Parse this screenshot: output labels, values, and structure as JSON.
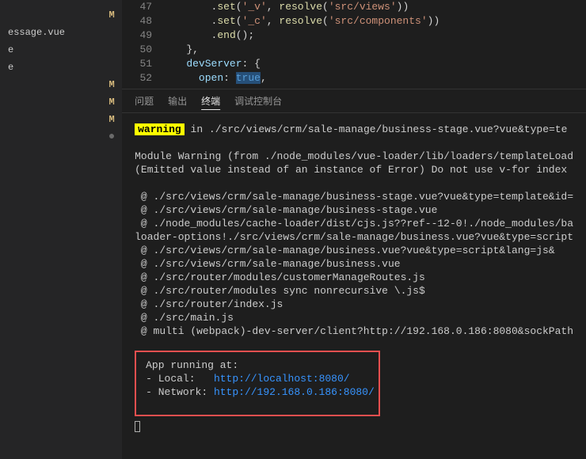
{
  "sidebar": {
    "items": [
      {
        "name": "",
        "status": "M"
      },
      {
        "name": "essage.vue",
        "status": ""
      },
      {
        "name": "e",
        "status": ""
      },
      {
        "name": "e",
        "status": ""
      },
      {
        "name": "",
        "status": "M"
      },
      {
        "name": "",
        "status": "M"
      },
      {
        "name": "",
        "status": "M"
      },
      {
        "name": "",
        "status": "●"
      }
    ]
  },
  "editor": {
    "lines": [
      {
        "num": "47",
        "indent": "        ",
        "tokens": [
          ".",
          "set",
          "(",
          "'_v'",
          ", ",
          "resolve",
          "(",
          "'src/views'",
          "))"
        ]
      },
      {
        "num": "48",
        "indent": "        ",
        "tokens": [
          ".",
          "set",
          "(",
          "'_c'",
          ", ",
          "resolve",
          "(",
          "'src/components'",
          "))"
        ]
      },
      {
        "num": "49",
        "indent": "        ",
        "tokens": [
          ".",
          "end",
          "();"
        ]
      },
      {
        "num": "50",
        "indent": "    ",
        "tokens": [
          "},"
        ]
      },
      {
        "num": "51",
        "indent": "    ",
        "prop": "devServer",
        "tokens": [
          ": {"
        ]
      },
      {
        "num": "52",
        "indent": "      ",
        "prop": "open",
        "tokens": [
          ": "
        ],
        "kwval": "true",
        "after": ","
      }
    ]
  },
  "panel": {
    "tabs": {
      "problems": "问题",
      "output": "输出",
      "terminal": "终端",
      "debug": "调试控制台"
    }
  },
  "terminal": {
    "warning_label": "warning",
    "warning_text": " in ./src/views/crm/sale-manage/business-stage.vue?vue&type=te",
    "module_line1": "Module Warning (from ./node_modules/vue-loader/lib/loaders/templateLoad",
    "module_line2": "(Emitted value instead of an instance of Error) Do not use v-for index ",
    "at": [
      " @ ./src/views/crm/sale-manage/business-stage.vue?vue&type=template&id=",
      " @ ./src/views/crm/sale-manage/business-stage.vue",
      " @ ./node_modules/cache-loader/dist/cjs.js??ref--12-0!./node_modules/ba",
      "loader-options!./src/views/crm/sale-manage/business.vue?vue&type=script",
      " @ ./src/views/crm/sale-manage/business.vue?vue&type=script&lang=js&",
      " @ ./src/views/crm/sale-manage/business.vue",
      " @ ./src/router/modules/customerManageRoutes.js",
      " @ ./src/router/modules sync nonrecursive \\.js$",
      " @ ./src/router/index.js",
      " @ ./src/main.js",
      " @ multi (webpack)-dev-server/client?http://192.168.0.186:8080&sockPath"
    ],
    "running": {
      "title": "App running at:",
      "local_label": "- Local:   ",
      "local_url_prefix": "http://localhost:",
      "local_port": "8080",
      "local_suffix": "/",
      "network_label": "- Network: ",
      "network_url_prefix": "http://192.168.0.186:",
      "network_port": "8080",
      "network_suffix": "/"
    }
  }
}
